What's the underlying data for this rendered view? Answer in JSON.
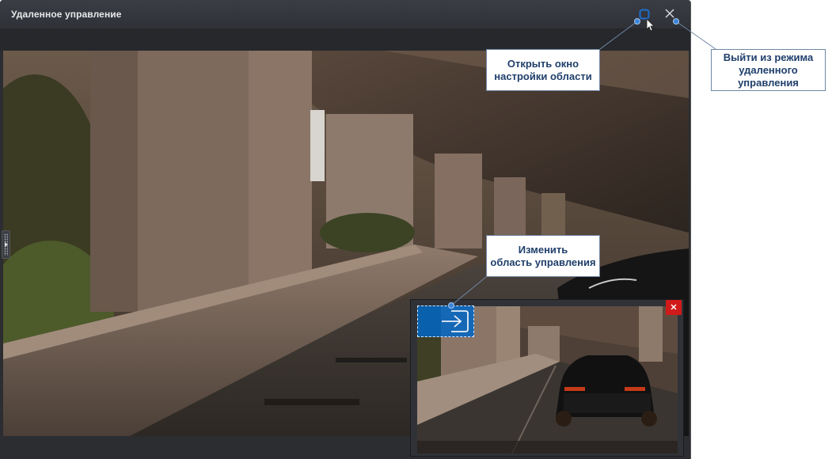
{
  "window": {
    "title": "Удаленное управление"
  },
  "titlebar_controls": {
    "settings_icon": "region-settings-icon",
    "close_icon": "close-icon"
  },
  "callouts": {
    "settings": "Открыть окно\nнастройки области",
    "exit": "Выйти из режима\nудаленного управления",
    "region": "Изменить\nобласть управления"
  },
  "inset": {
    "close_icon": "close-icon",
    "region_icon": "enter-arrow-icon"
  },
  "colors": {
    "accent_blue": "#0066c4",
    "callout_text": "#1f3f6b",
    "close_red": "#d11a1a",
    "window_bg": "#2b2d31"
  }
}
